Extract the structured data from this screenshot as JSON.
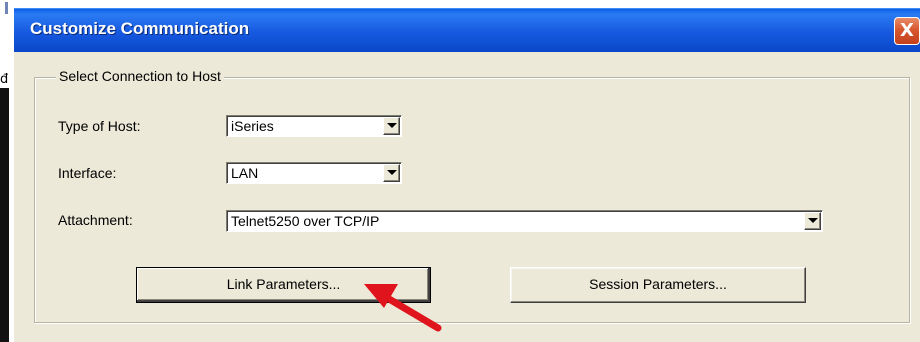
{
  "window": {
    "title": "Customize Communication",
    "close_label": "X"
  },
  "group": {
    "legend": "Select Connection to Host"
  },
  "fields": {
    "host_type": {
      "label": "Type of Host:",
      "value": "iSeries"
    },
    "interface": {
      "label": "Interface:",
      "value": "LAN"
    },
    "attachment": {
      "label": "Attachment:",
      "value": "Telnet5250 over TCP/IP"
    }
  },
  "buttons": {
    "link_parameters": "Link Parameters...",
    "session_parameters": "Session Parameters..."
  },
  "background": {
    "glyph": "đ"
  },
  "colors": {
    "titlebar": "#0a47c8",
    "dialog_face": "#ece9d8",
    "annotation_arrow": "#e0141c",
    "close_button": "#d8582f"
  },
  "icons": [
    "close-icon",
    "dropdown-arrow-icon",
    "annotation-arrow-icon"
  ]
}
